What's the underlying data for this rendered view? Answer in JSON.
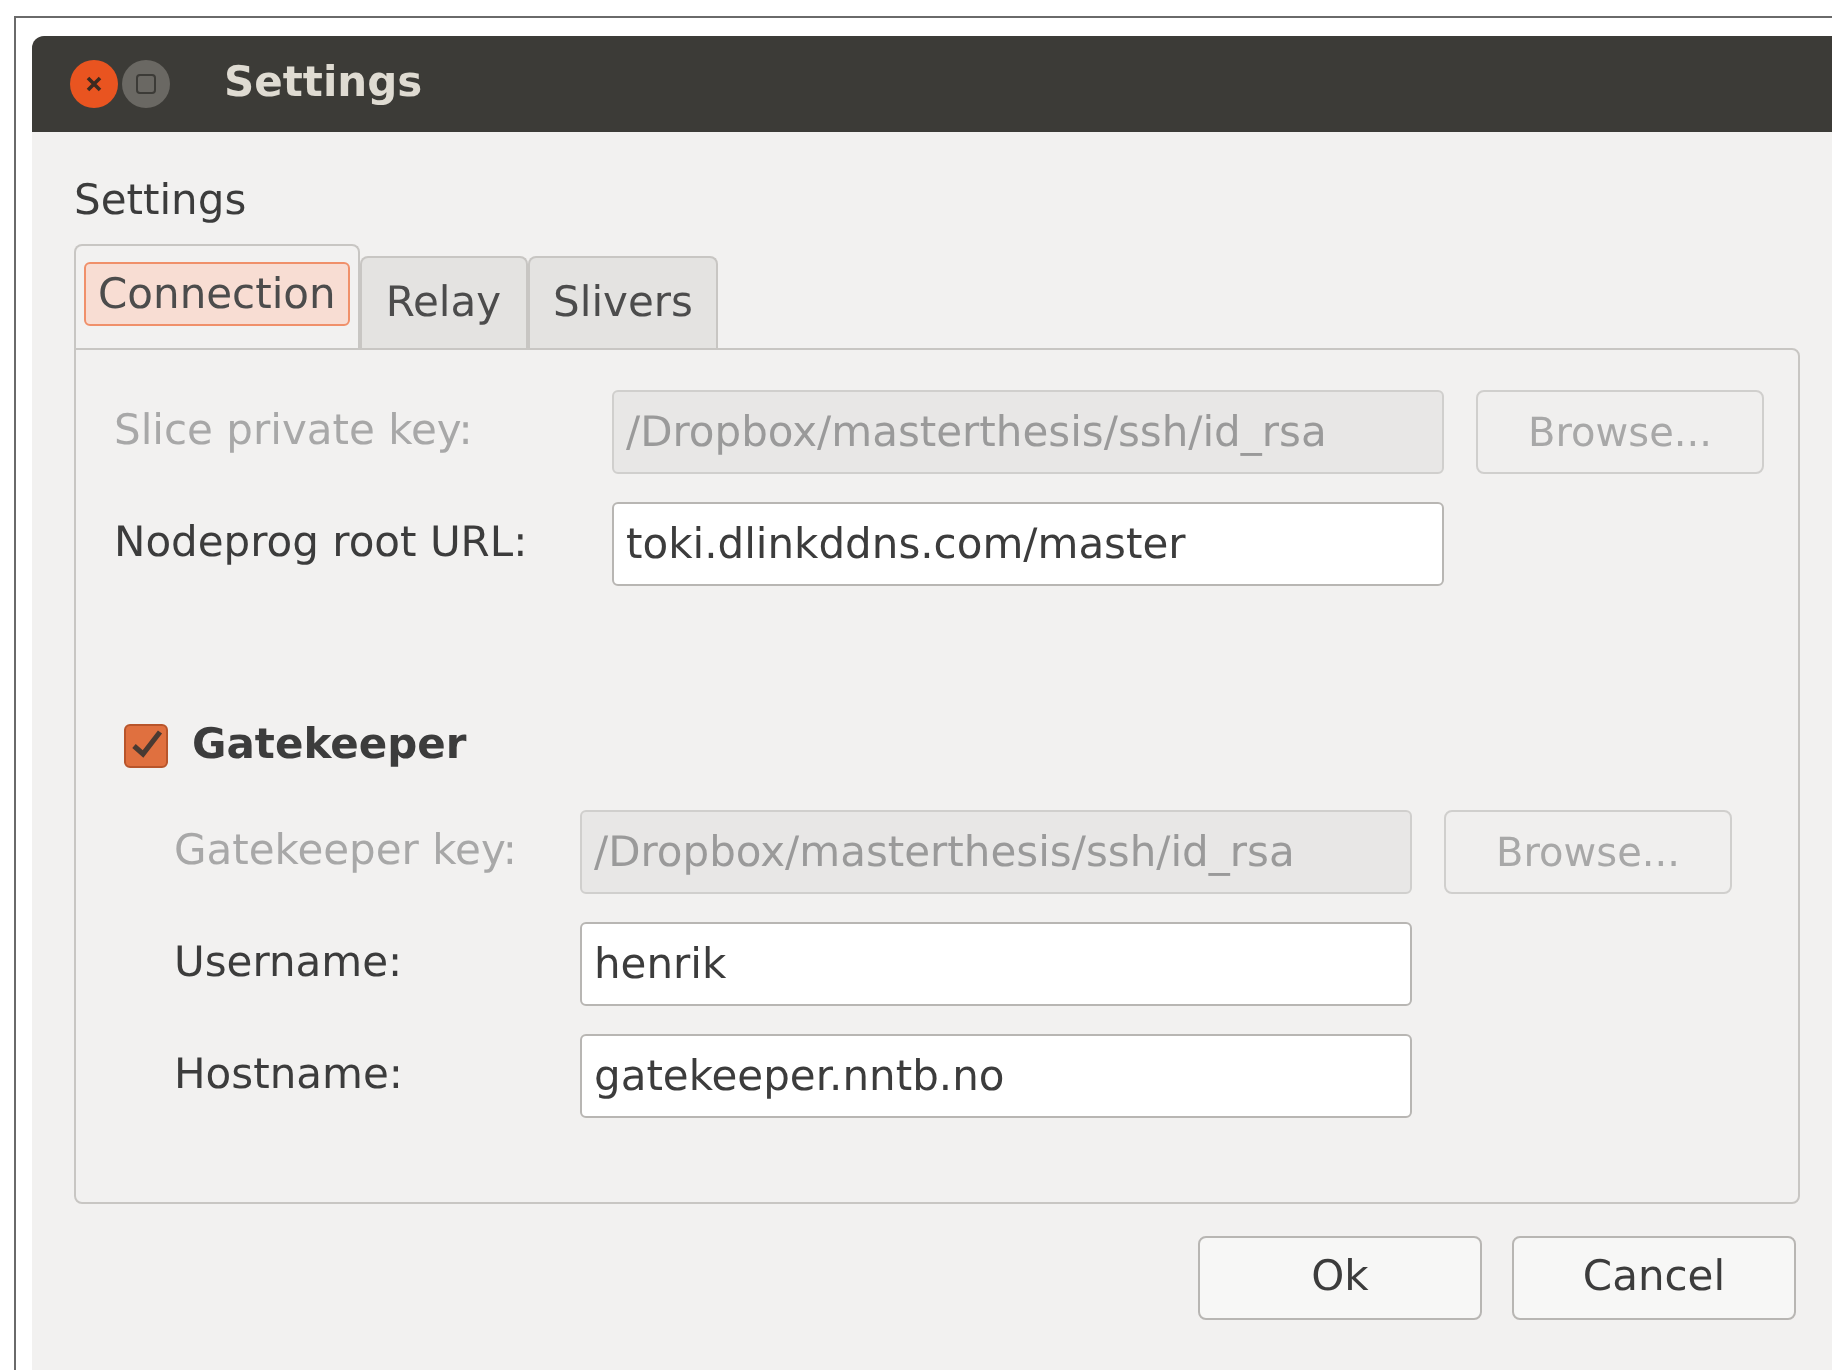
{
  "window": {
    "title": "Settings"
  },
  "heading": "Settings",
  "tabs": [
    {
      "label": "Connection",
      "selected": true
    },
    {
      "label": "Relay",
      "selected": false
    },
    {
      "label": "Slivers",
      "selected": false
    }
  ],
  "fields": [
    {
      "label": "Slice private key:",
      "value": "/Dropbox/masterthesis/ssh/id_rsa",
      "disabled": true,
      "browse": "Browse..."
    },
    {
      "label": "Nodeprog root URL:",
      "value": "toki.dlinkddns.com/master",
      "disabled": false
    }
  ],
  "gatekeeper": {
    "label": "Gatekeeper",
    "checked": true,
    "fields": [
      {
        "label": "Gatekeeper key:",
        "value": "/Dropbox/masterthesis/ssh/id_rsa",
        "disabled": true,
        "browse": "Browse..."
      },
      {
        "label": "Username:",
        "value": "henrik",
        "disabled": false
      },
      {
        "label": "Hostname:",
        "value": "gatekeeper.nntb.no",
        "disabled": false
      }
    ]
  },
  "buttons": [
    "Ok",
    "Cancel"
  ]
}
